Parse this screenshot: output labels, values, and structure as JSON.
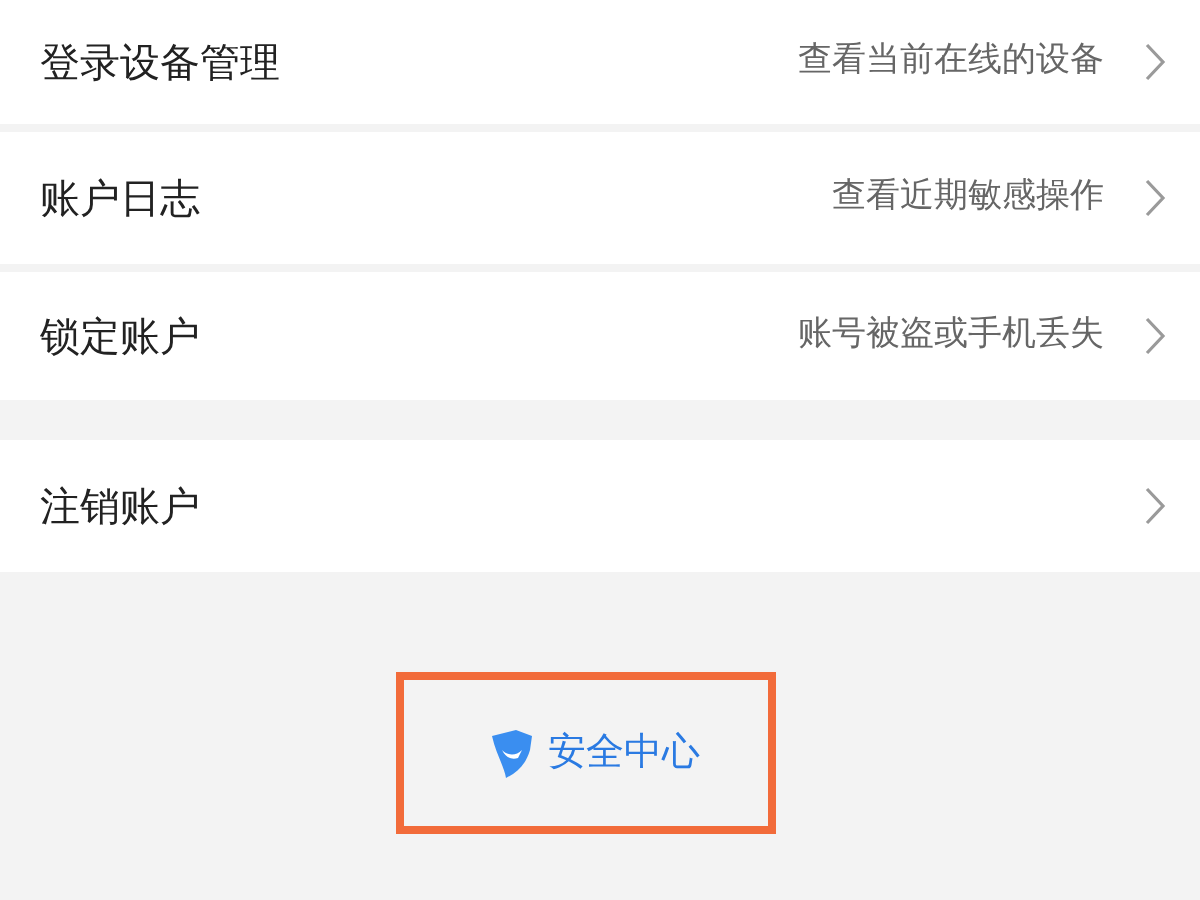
{
  "groups": [
    {
      "items": [
        {
          "label": "登录设备管理",
          "detail": "查看当前在线的设备"
        },
        {
          "label": "账户日志",
          "detail": "查看近期敏感操作"
        },
        {
          "label": "锁定账户",
          "detail": "账号被盗或手机丢失"
        }
      ]
    },
    {
      "items": [
        {
          "label": "注销账户"
        }
      ]
    }
  ],
  "footer_link": {
    "label": "安全中心",
    "highlighted": true
  }
}
